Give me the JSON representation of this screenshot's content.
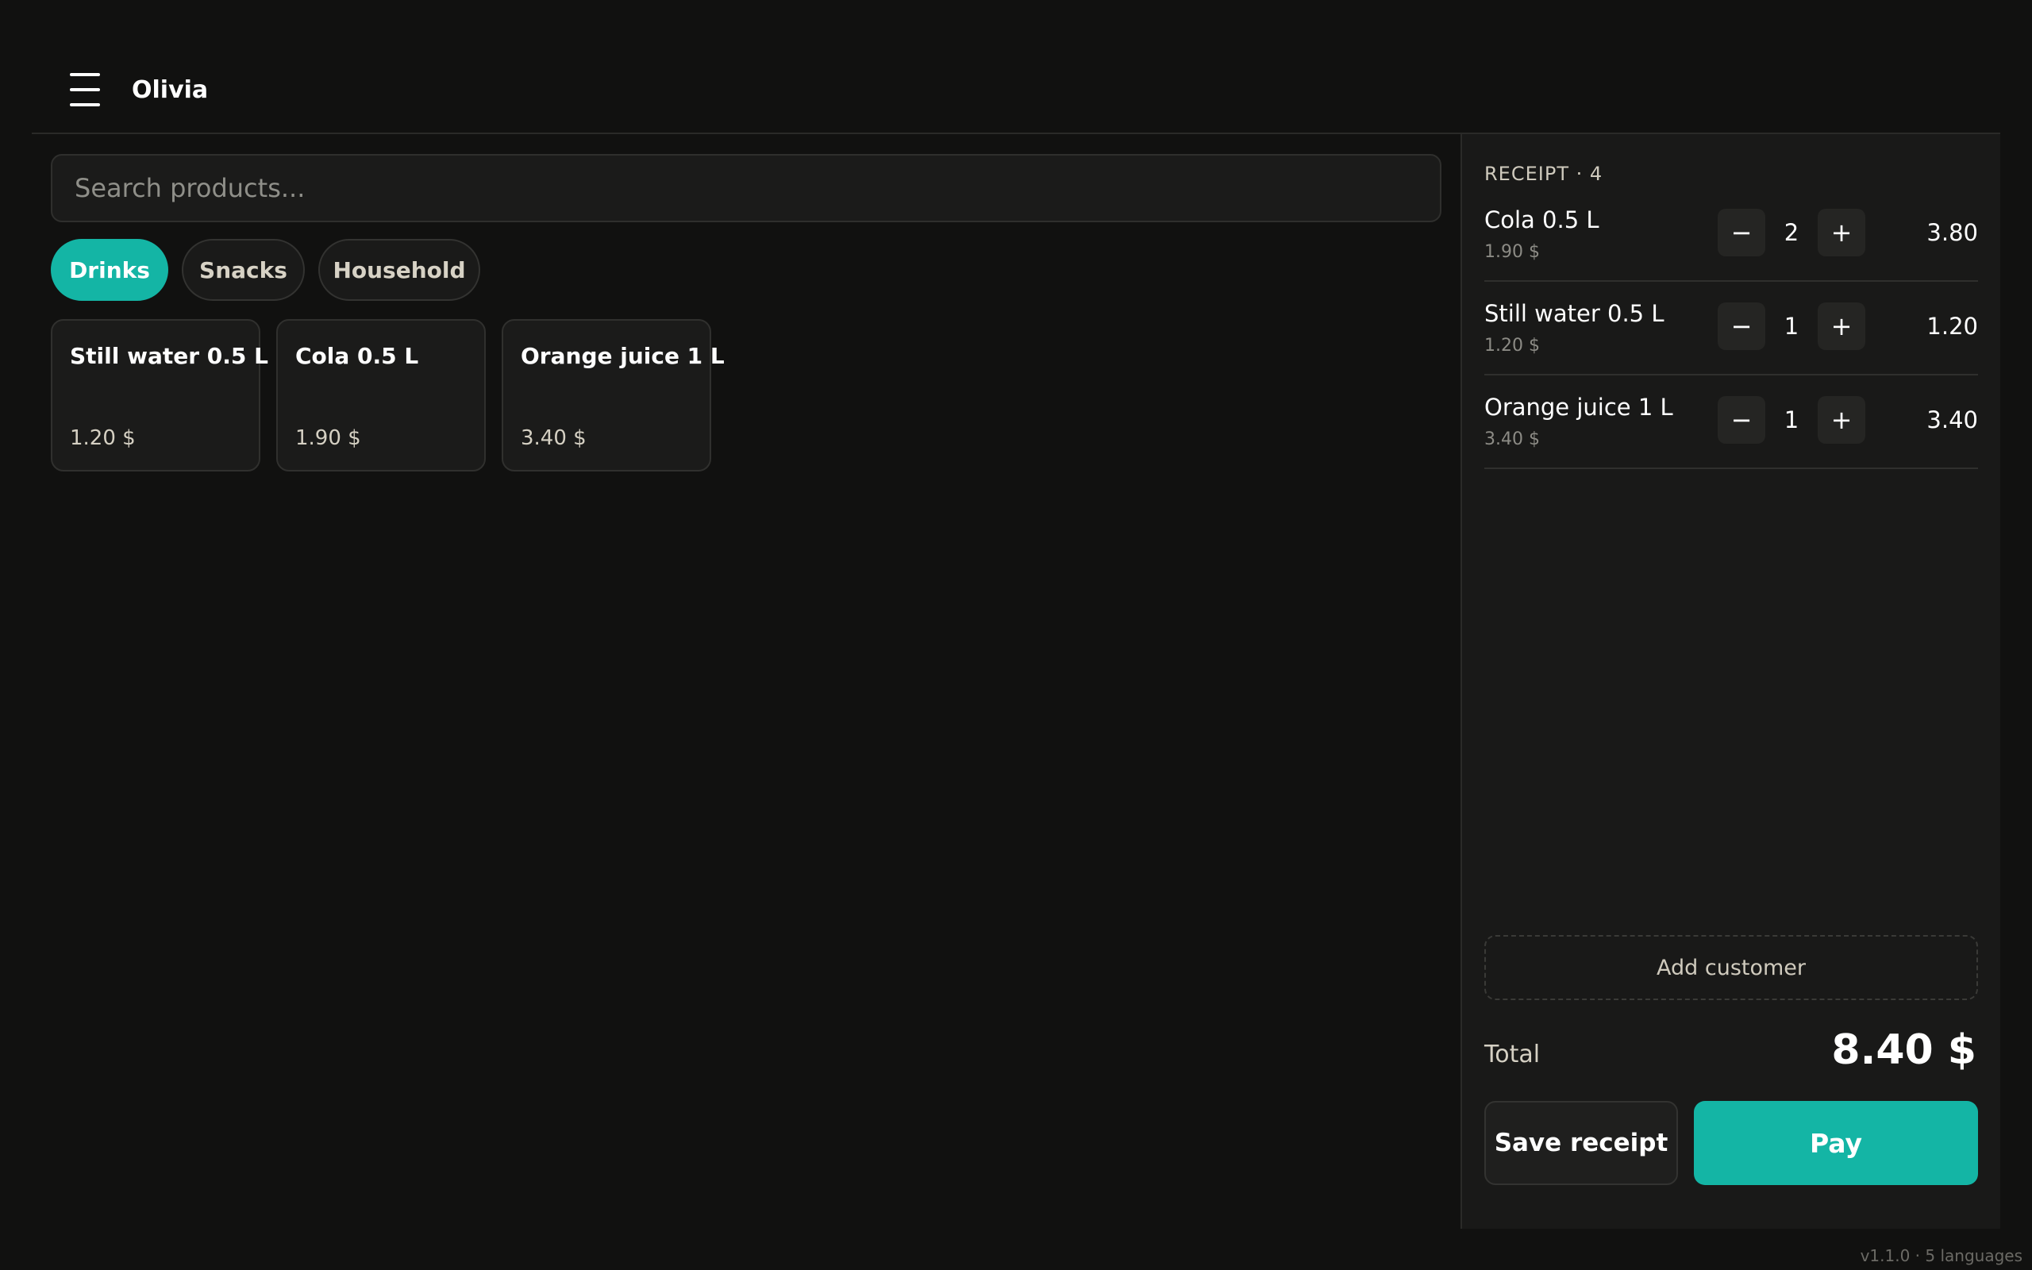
{
  "header": {
    "user_name": "Olivia",
    "menu_icon": "hamburger-menu-icon"
  },
  "search": {
    "placeholder": "Search products..."
  },
  "categories": [
    {
      "label": "Drinks",
      "active": true
    },
    {
      "label": "Snacks",
      "active": false
    },
    {
      "label": "Household",
      "active": false
    }
  ],
  "products": [
    {
      "name": "Still water 0.5 L",
      "price": "1.20 $"
    },
    {
      "name": "Cola 0.5 L",
      "price": "1.90 $"
    },
    {
      "name": "Orange juice 1 L",
      "price": "3.40 $"
    }
  ],
  "receipt": {
    "title": "RECEIPT · 4",
    "lines": [
      {
        "name": "Cola 0.5 L",
        "unit_price": "1.90 $",
        "qty": "2",
        "total": "3.80"
      },
      {
        "name": "Still water 0.5 L",
        "unit_price": "1.20 $",
        "qty": "1",
        "total": "1.20"
      },
      {
        "name": "Orange juice 1 L",
        "unit_price": "3.40 $",
        "qty": "1",
        "total": "3.40"
      }
    ],
    "minus_label": "−",
    "plus_label": "+",
    "add_customer_label": "Add customer",
    "total_label": "Total",
    "total_value": "8.40 $",
    "save_label": "Save receipt",
    "pay_label": "Pay"
  },
  "footer": {
    "version": "v1.1.0 · 5 languages"
  },
  "colors": {
    "accent": "#14b5a5",
    "background": "#111110",
    "panel": "#191918"
  }
}
